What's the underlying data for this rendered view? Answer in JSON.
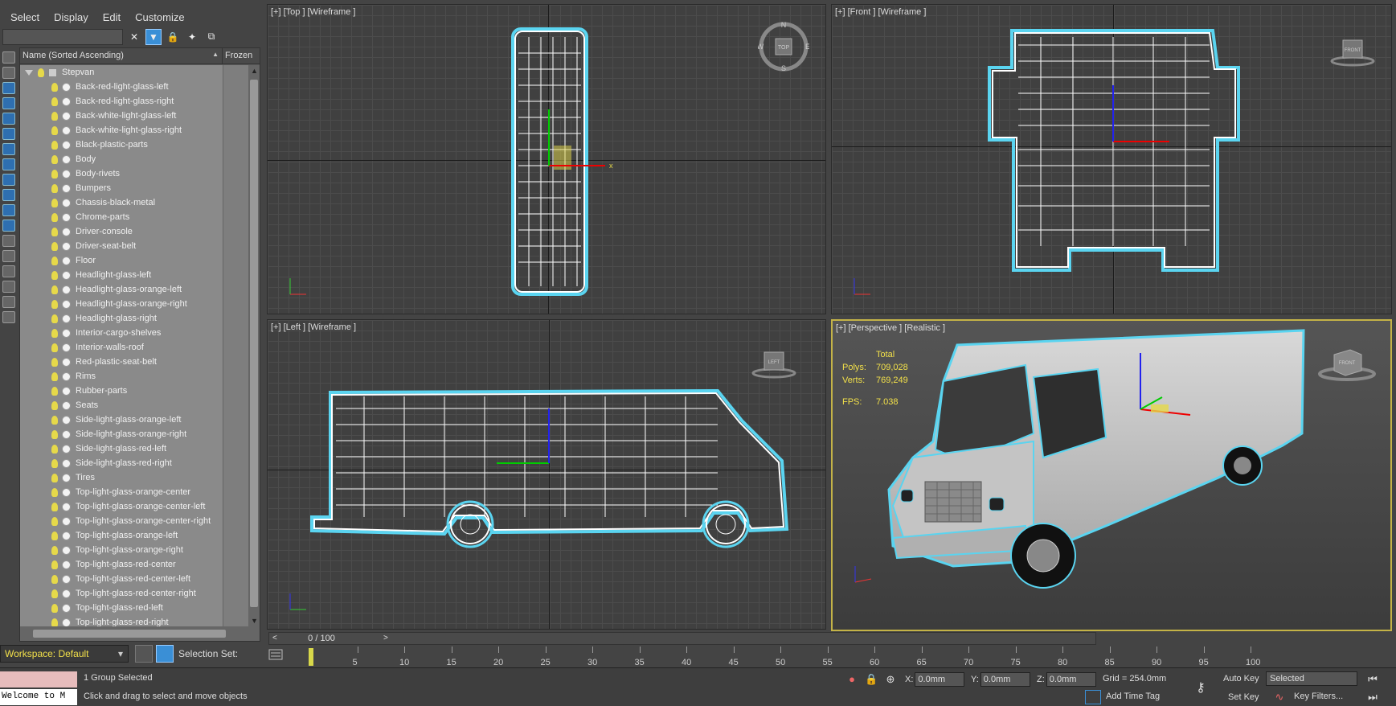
{
  "menu": [
    "Select",
    "Display",
    "Edit",
    "Customize"
  ],
  "explorer": {
    "col_name": "Name (Sorted Ascending)",
    "col_frozen": "Frozen",
    "root": "Stepvan",
    "items": [
      "Back-red-light-glass-left",
      "Back-red-light-glass-right",
      "Back-white-light-glass-left",
      "Back-white-light-glass-right",
      "Black-plastic-parts",
      "Body",
      "Body-rivets",
      "Bumpers",
      "Chassis-black-metal",
      "Chrome-parts",
      "Driver-console",
      "Driver-seat-belt",
      "Floor",
      "Headlight-glass-left",
      "Headlight-glass-orange-left",
      "Headlight-glass-orange-right",
      "Headlight-glass-right",
      "Interior-cargo-shelves",
      "Interior-walls-roof",
      "Red-plastic-seat-belt",
      "Rims",
      "Rubber-parts",
      "Seats",
      "Side-light-glass-orange-left",
      "Side-light-glass-orange-right",
      "Side-light-glass-red-left",
      "Side-light-glass-red-right",
      "Tires",
      "Top-light-glass-orange-center",
      "Top-light-glass-orange-center-left",
      "Top-light-glass-orange-center-right",
      "Top-light-glass-orange-left",
      "Top-light-glass-orange-right",
      "Top-light-glass-red-center",
      "Top-light-glass-red-center-left",
      "Top-light-glass-red-center-right",
      "Top-light-glass-red-left",
      "Top-light-glass-red-right"
    ]
  },
  "workspace": "Workspace: Default",
  "selection_set": "Selection Set:",
  "viewports": {
    "top": "[+] [Top ] [Wireframe ]",
    "front": "[+] [Front ] [Wireframe ]",
    "left": "[+] [Left ] [Wireframe ]",
    "persp": "[+] [Perspective ] [Realistic ]"
  },
  "viewcube": {
    "top": "TOP",
    "front": "FRONT",
    "left": "LEFT",
    "persp": "FRONT",
    "n": "N",
    "s": "S",
    "e": "E",
    "w": "W"
  },
  "stats": {
    "total": "Total",
    "polys_label": "Polys:",
    "polys": "709,028",
    "verts_label": "Verts:",
    "verts": "769,249",
    "fps_label": "FPS:",
    "fps": "7.038"
  },
  "timeline": {
    "frame": "0 / 100",
    "ticks": [
      "5",
      "10",
      "15",
      "20",
      "25",
      "30",
      "35",
      "40",
      "45",
      "50",
      "55",
      "60",
      "65",
      "70",
      "75",
      "80",
      "85",
      "90",
      "95",
      "100"
    ]
  },
  "status": {
    "maxscript": "Welcome to M",
    "selection": "1 Group Selected",
    "prompt": "Click and drag to select and move objects",
    "x_label": "X:",
    "x": "0.0mm",
    "y_label": "Y:",
    "y": "0.0mm",
    "z_label": "Z:",
    "z": "0.0mm",
    "grid": "Grid = 254.0mm",
    "add_time_tag": "Add Time Tag",
    "auto_key": "Auto Key",
    "set_key": "Set Key",
    "selected": "Selected",
    "key_filters": "Key Filters..."
  }
}
